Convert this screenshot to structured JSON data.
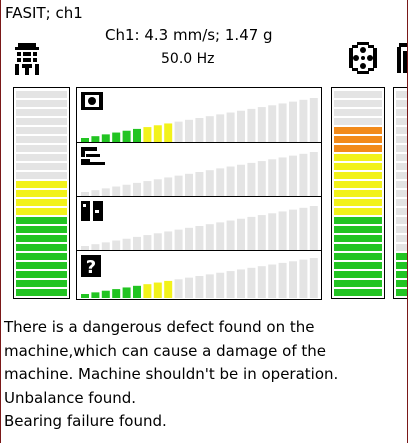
{
  "title": "FASIT; ch1",
  "summary": {
    "line1": "Ch1: 4.3 mm/s; 1.47 g",
    "line2": "50.0 Hz"
  },
  "colors": {
    "frame": "#7a1818",
    "inactive": "#e4e4e4",
    "green": "#22c422",
    "yellow": "#f2f21a",
    "orange": "#f28a1a"
  },
  "gauges": {
    "velocity_level": 0.56,
    "acceleration_level": 0.83,
    "right_partial_level": 0.22
  },
  "fault_rows": [
    {
      "icon": "unbalance-icon",
      "level": 0.42
    },
    {
      "icon": "misalignment-icon",
      "level": 0.0
    },
    {
      "icon": "looseness-icon",
      "level": 0.0
    },
    {
      "icon": "unknown-fault-icon",
      "level": 0.42
    }
  ],
  "message": {
    "lines": [
      "There is a dangerous defect found on the",
      "machine,which can cause a damage of the",
      "machine. Machine shouldn't be in operation.",
      "Unbalance found.",
      "Bearing failure found."
    ]
  }
}
